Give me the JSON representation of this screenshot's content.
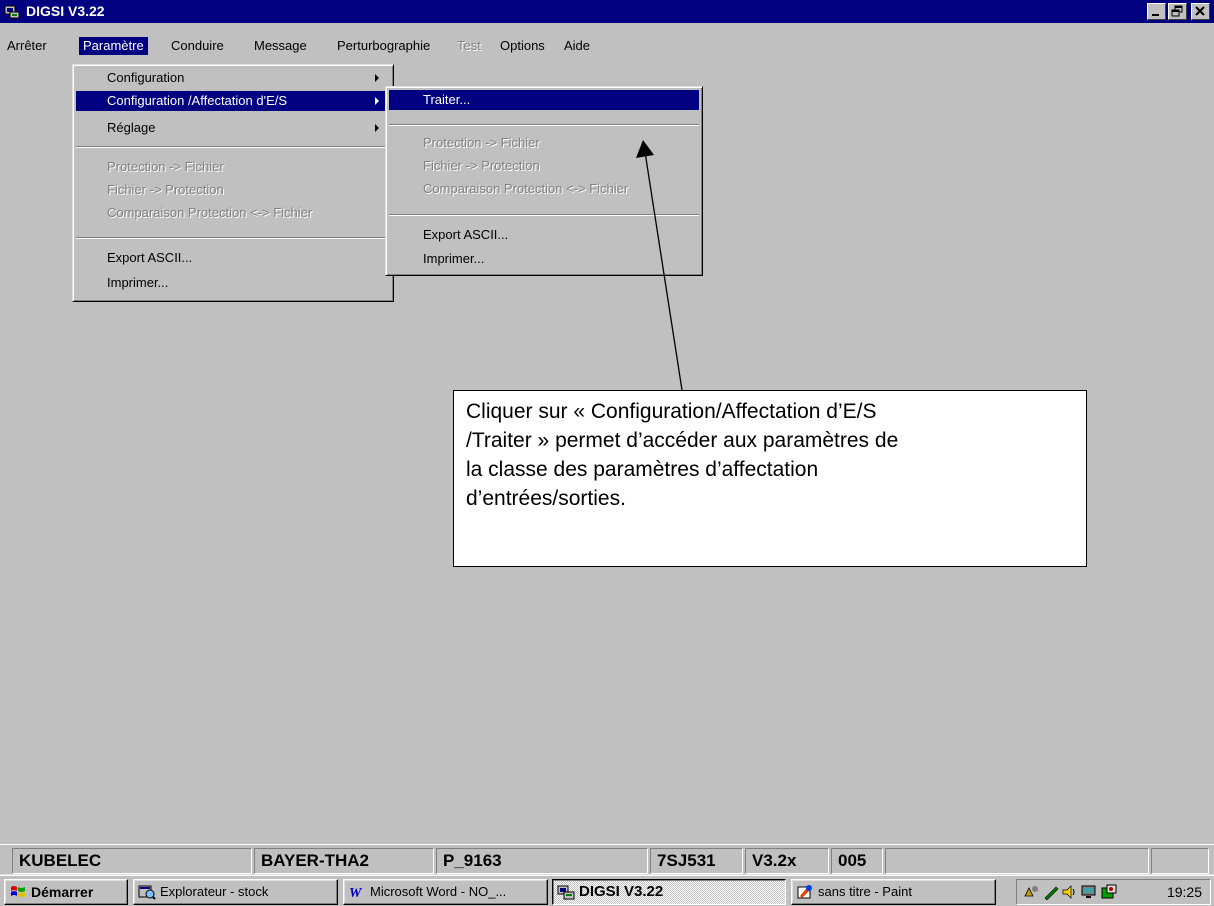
{
  "window": {
    "title": "DIGSI  V3.22"
  },
  "menubar": {
    "items": [
      {
        "label": "Arrêter"
      },
      {
        "label": "Paramètre"
      },
      {
        "label": "Conduire"
      },
      {
        "label": "Message"
      },
      {
        "label": "Perturbographie"
      },
      {
        "label": "Test"
      },
      {
        "label": "Options"
      },
      {
        "label": "Aide"
      }
    ]
  },
  "parametre_menu": {
    "items": [
      {
        "label": "Configuration"
      },
      {
        "label": "Configuration /Affectation d'E/S"
      },
      {
        "label": "Réglage"
      },
      {
        "label": "Protection -> Fichier"
      },
      {
        "label": "Fichier -> Protection"
      },
      {
        "label": "Comparaison Protection <-> Fichier"
      },
      {
        "label": "Export ASCII..."
      },
      {
        "label": "Imprimer..."
      }
    ]
  },
  "submenu": {
    "items": [
      {
        "label": "Traiter..."
      },
      {
        "label": "Protection -> Fichier"
      },
      {
        "label": "Fichier -> Protection"
      },
      {
        "label": "Comparaison Protection <-> Fichier"
      },
      {
        "label": "Export ASCII..."
      },
      {
        "label": "Imprimer..."
      }
    ]
  },
  "callout": {
    "text": "Cliquer sur « Configuration/Affectation d’E/S\n/Traiter » permet d’accéder aux paramètres de\nla classe des paramètres d’affectation\nd’entrées/sorties."
  },
  "statusbar": {
    "cells": [
      "KUBELEC",
      "BAYER-THA2",
      "P_9163",
      "7SJ531",
      "V3.2x",
      "005",
      "",
      ""
    ]
  },
  "taskbar": {
    "start": "Démarrer",
    "tasks": [
      "Explorateur - stock",
      "Microsoft Word - NO_...",
      "DIGSI  V3.22",
      "sans titre - Paint"
    ],
    "clock": "19:25"
  }
}
